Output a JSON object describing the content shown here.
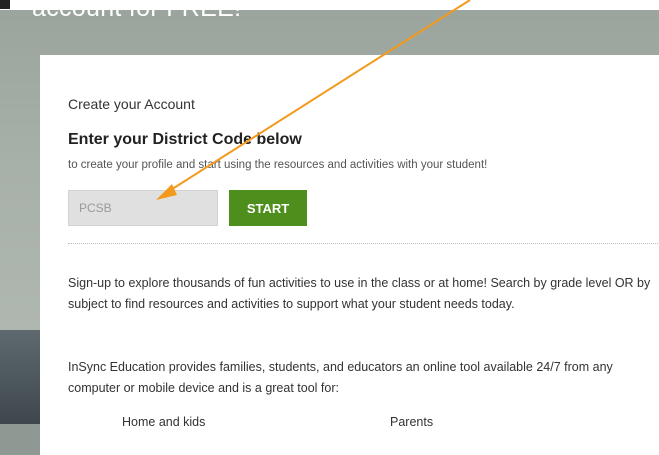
{
  "hero": {
    "heading_fragment": "account for FREE!"
  },
  "panel": {
    "create_title": "Create your Account",
    "code_title": "Enter your District Code below",
    "code_subtitle": "to create your profile and start using the resources and activities with your student!",
    "code_input_value": "PCSB",
    "start_label": "START",
    "paragraph1": "Sign-up to explore thousands of fun activities to use in the class or at home! Search by grade level OR by subject to find resources and activities to support what your student needs today.",
    "paragraph2": "InSync Education provides families, students, and educators an online tool available 24/7 from any computer or mobile device and is a great tool for:",
    "cutoff_left": "Home and kids",
    "cutoff_right": "Parents"
  },
  "colors": {
    "start_button": "#4d8e1c",
    "annotation_arrow": "#f39a1e"
  }
}
